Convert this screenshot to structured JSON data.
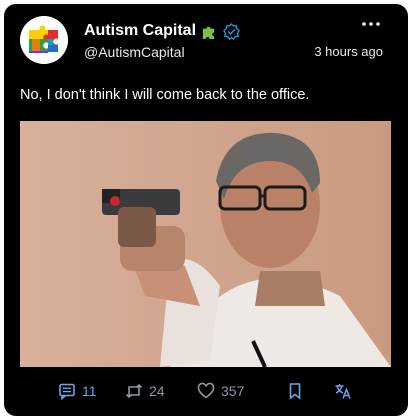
{
  "post": {
    "display_name": "Autism Capital",
    "handle": "@AutismCapital",
    "timestamp": "3 hours ago",
    "text": "No, I don't think I will come back to the office.",
    "badges": [
      "puzzle-piece-icon",
      "verified-icon"
    ]
  },
  "actions": {
    "replies": "11",
    "retweets": "24",
    "likes": "357"
  },
  "colors": {
    "card_background": "#000000",
    "accent_blue": "#1d9bf0",
    "muted": "#8b98a5",
    "badge_green": "#7bc043"
  }
}
